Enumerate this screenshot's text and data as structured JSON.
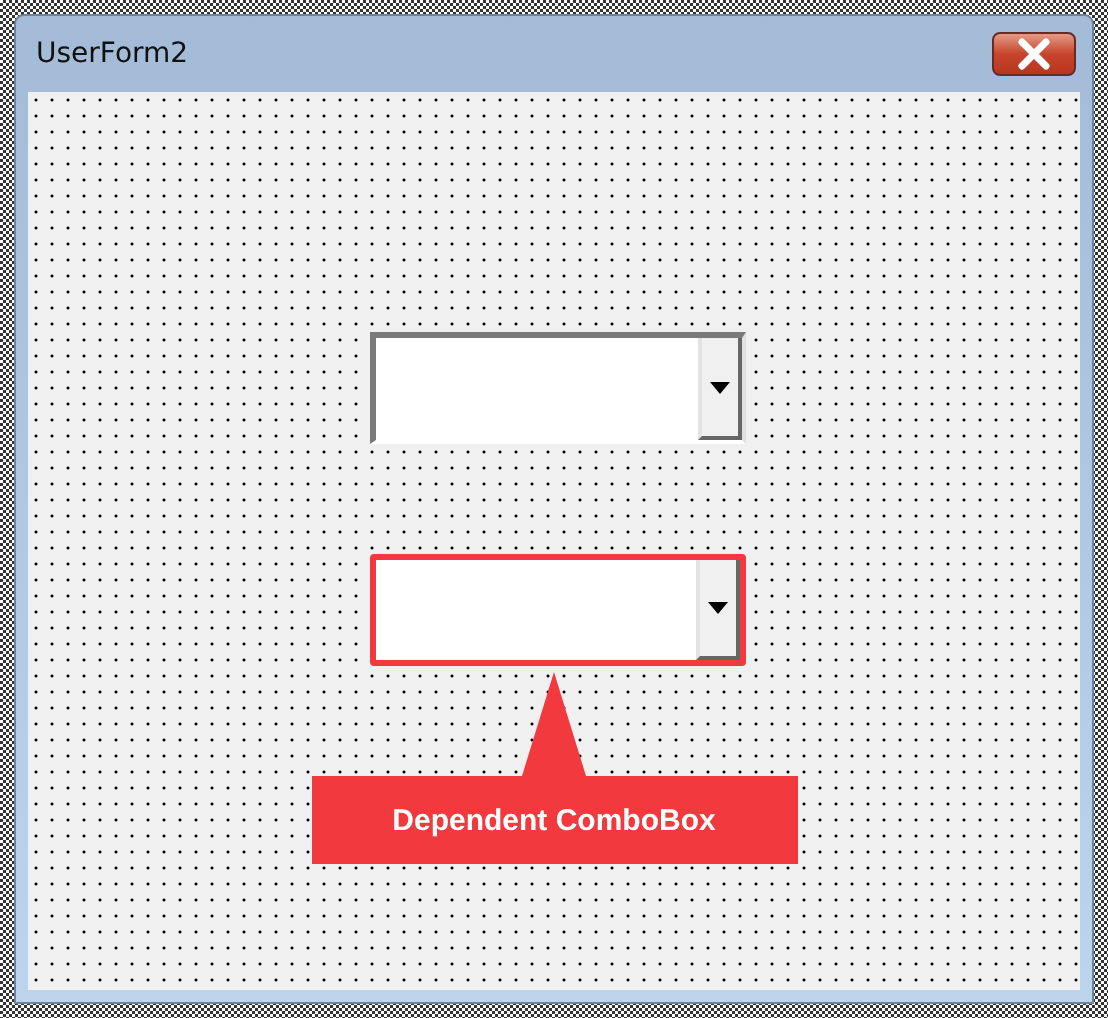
{
  "window": {
    "title": "UserForm2"
  },
  "comboboxes": [
    {
      "highlighted": false
    },
    {
      "highlighted": true
    }
  ],
  "callout": {
    "label": "Dependent ComboBox"
  }
}
